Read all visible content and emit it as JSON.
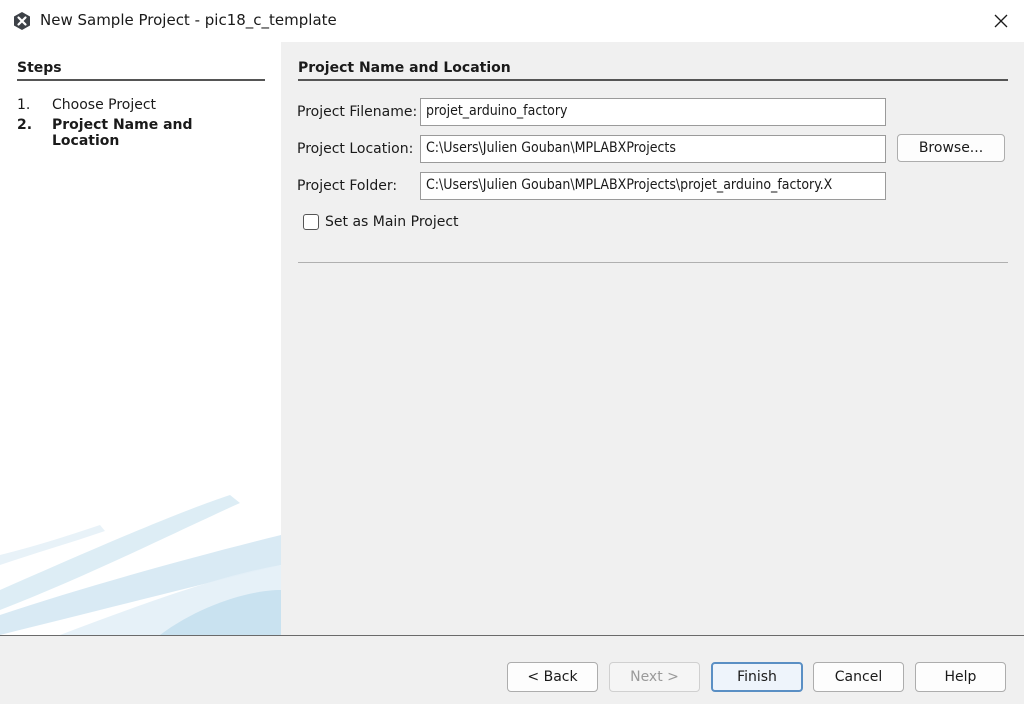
{
  "window": {
    "title": "New Sample Project - pic18_c_template",
    "app_icon": "mplab-x-icon",
    "close_icon": "close-icon"
  },
  "steps": {
    "heading": "Steps",
    "items": [
      {
        "num": "1.",
        "label": "Choose Project",
        "active": false
      },
      {
        "num": "2.",
        "label": "Project Name and Location",
        "active": true
      }
    ]
  },
  "form": {
    "heading": "Project Name and Location",
    "filename_label": "Project Filename:",
    "filename_value": "projet_arduino_factory",
    "location_label": "Project Location:",
    "location_value": "C:\\Users\\Julien Gouban\\MPLABXProjects",
    "folder_label": "Project Folder:",
    "folder_value": "C:\\Users\\Julien Gouban\\MPLABXProjects\\projet_arduino_factory.X",
    "browse_label": "Browse...",
    "main_project_label": "Set as Main Project",
    "main_project_checked": false
  },
  "buttons": {
    "back": "< Back",
    "next": "Next >",
    "finish": "Finish",
    "cancel": "Cancel",
    "help": "Help"
  },
  "colors": {
    "accent": "#5a8fc4",
    "panel_bg": "#f0f0f0"
  }
}
